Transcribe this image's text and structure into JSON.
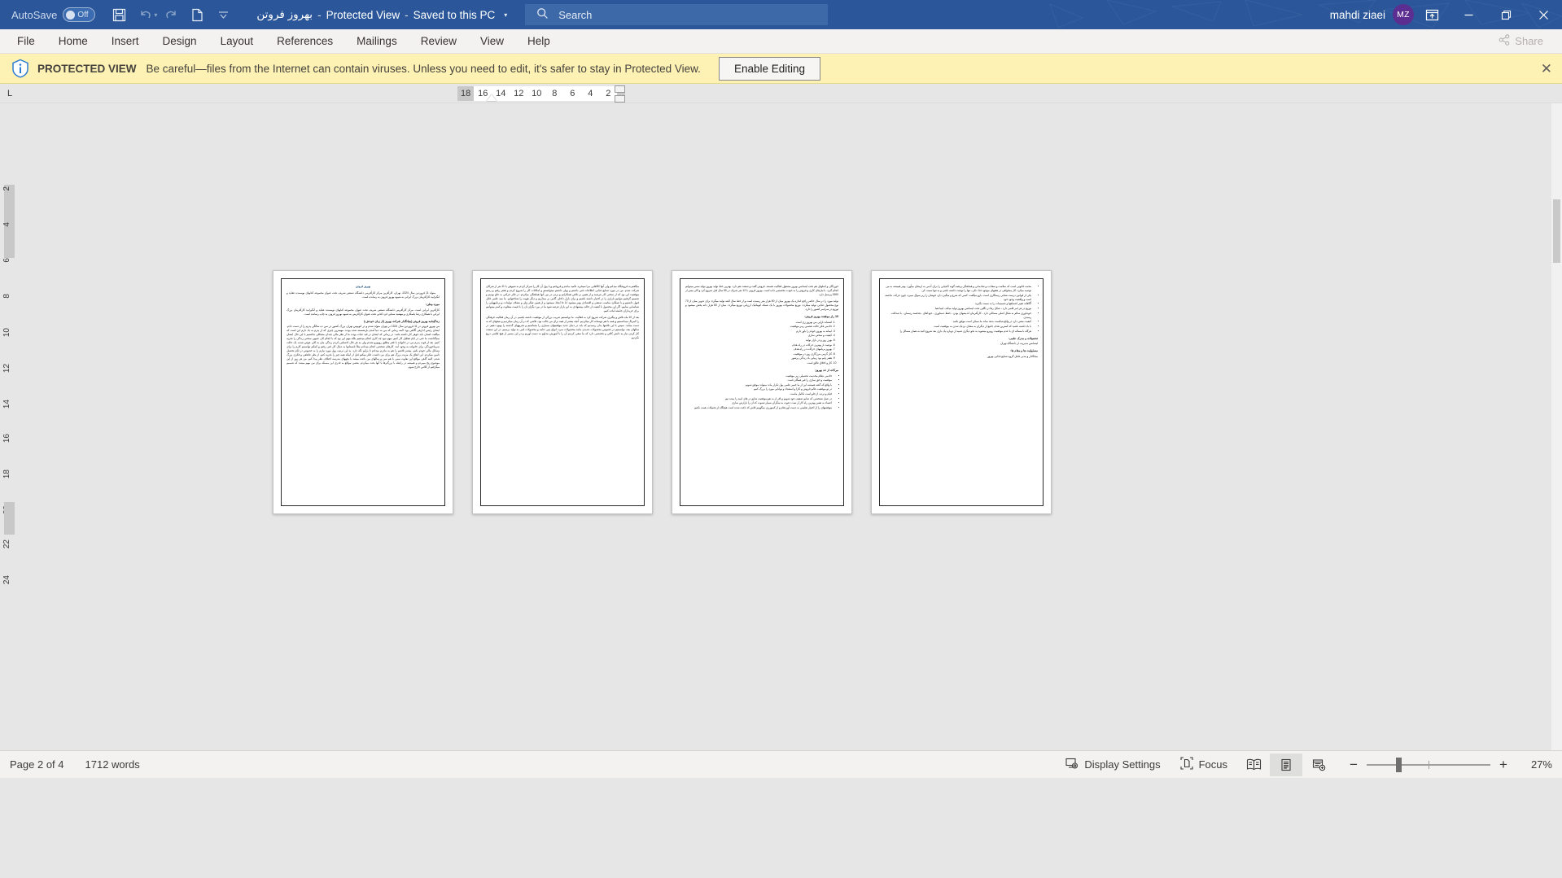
{
  "titlebar": {
    "autosave_label": "AutoSave",
    "autosave_state": "Off",
    "doc_name": "بهروز فروتن",
    "protected_view": "Protected View",
    "saved_state": "Saved to this PC",
    "sep": "-",
    "search_placeholder": "Search",
    "user_name": "mahdi ziaei",
    "avatar_initials": "MZ",
    "icons": {
      "save": "save-icon",
      "undo": "undo-icon",
      "redo": "redo-icon",
      "new": "new-document-icon",
      "customize": "customize-quick-access-toolbar-icon",
      "search": "search-icon",
      "ribbon_display": "ribbon-display-options-icon",
      "minimize": "minimize-icon",
      "restore": "restore-icon",
      "close": "close-icon"
    },
    "accent_color": "#2b579a",
    "avatar_color": "#5c2e91"
  },
  "ribbon": {
    "tabs": [
      {
        "label": "File"
      },
      {
        "label": "Home"
      },
      {
        "label": "Insert"
      },
      {
        "label": "Design"
      },
      {
        "label": "Layout"
      },
      {
        "label": "References"
      },
      {
        "label": "Mailings"
      },
      {
        "label": "Review"
      },
      {
        "label": "View"
      },
      {
        "label": "Help"
      }
    ],
    "share_label": "Share"
  },
  "protected_view": {
    "badge": "PROTECTED VIEW",
    "message": "Be careful—files from the Internet can contain viruses. Unless you need to edit, it's safer to stay in Protected View.",
    "enable_button": "Enable Editing",
    "close_glyph": "✕",
    "bar_color": "#fdf2b3"
  },
  "ruler": {
    "corner_glyph": "L",
    "margin_label": "18",
    "ticks": [
      "16",
      "14",
      "12",
      "10",
      "8",
      "6",
      "4",
      "2"
    ],
    "vertical_ticks": [
      "2",
      "4",
      "6",
      "8",
      "10",
      "12",
      "14",
      "16",
      "18",
      "20",
      "22",
      "24"
    ]
  },
  "document": {
    "pages": [
      {
        "title": "بهروز فروتن",
        "blocks": [
          {
            "type": "p",
            "text": "متولد 11 فروردین سال 1324، تهران، کارآفرین مرکز کارآفرینی دانشگاه صنعتی شریف تحت عنوان مجموعه کتابهای نویسنده عقاید و انگیزانید کارآفرینان بزرگ ایرانی به شیوه بهروز فروتن به رسانده است."
          },
          {
            "type": "h",
            "text": "موزه وطن:"
          },
          {
            "type": "p",
            "text": "کارآفرین ایرانی است. مرکز کارآفرینی دانشگاه صنعتی شریف تحت عنوان مجموعه کتابهای نویسنده عقاید و انگیزانید کارآفرینان بزرگ ایرانی با همکاری رضا پاسکاری و مهشید سنایی فرد کتابی تحت عنوان کارآفرینی به شیوه بهروز فروتن به چاپ رسانده است."
          },
          {
            "type": "h",
            "text": "زندگینامه بهروز فروتن (بنیانگذار شرکت بهروز (از زبان خودش:)"
          },
          {
            "type": "p",
            "text": "من بهروز فروتن در 11 فروردین سال 1324 در تهران متولد شدم و در اتوبوس تهران بزرگ کشور در سن ده سالگی پدرم را از دست دادم. ایشان رئیس ادارهی آگاهی بود. البته زمانی که من به دنیا آمدم بازنشسته شده بودند. مهمترین چیزی که از پدرم به یاد دارم این است که میگفت انسان باید جوهر کار داشته باشد. در زمانی که ایشان در قید حیات بودند ما از نظر مالی چندان مشکلی نداشتیم با این حال ایشان نمیگذاشت ما حتی در ایام تعطیل کار کنیم. مهم نبود چه کاری انجام میدهیم بلکه مهم این بود که با انجام کار، جنبهی سختی زندگی را تجربه کنیم. بعد از فوت پدرم من در خانواده با فقر مطلق روبهرو نشدم ولی به هر حال احساس کردم زندگی مان به کلی عوض شده، یک حالت سرماخوردگی برای خانواده به وجود آمد. کارهای شخصی انجام میدادم مثلاً تابستانها به دنبال کار فنی رفتم و کمکم توانستم کارم را برای مسائل مالی خودم بکنم. بیشتر تلاشم را هم به مادرم میدادم تا برایم نگه دارد. به این ترتیب پول مورد نیازم را به خصوص در ایام تحصیل تأمین میکردم. این اتفاق یک مزیت بزرگ هم برای من داشت، فکر میکنم قبل از اینکه همه چیز را تجربه کنم، از نظر عاطفی و فکری بزرگ شدم. البته گاهی مواقع این تفاوت سنی با هم سن و سالهای من باعث میشد با بچههای مدرسه اختلاف نظر پیدا کنم. من هر روز از این موضوع رنج میبردم و همیشه در رابطه با بزرگترها با آنها بحث میکردم. بعضی مواقع به قدری این مسئله برای من مهم میشد که تصمیم میگرفتم از کلاس خارج شوم."
          }
        ]
      },
      {
        "blocks": [
          {
            "type": "p",
            "text": "میگفتم به فروشگاه میدانم ولی آنها کالاهایی مرا نمیخرید ناامید ماندم و فروختم و با پول آن کار را تمرکز کردم به شیوهی با 11 نفر از شرکای شرکت شدم. من در مورد صنایع غذایی اطلاعات فنی داشتم و پولی داشتم میتوانستم و امکانات کار را شروع کردم و هفتر رفتم و رسم موفقیت این بود که از سختی کار نترسید و از همین بر تلاش همکارانم و بردن در بین آنها هماهنگی میکردم. در فکر حرکتی به جلو بودیم و تصمیم گرفتیم بتوانیم بازاری را در اختیار داشته باشیم و برای بازار داخلی گامی بر میداریم و دیگر هویت را شناختهایم. ما بنیه علمی قابل قبول داشتیم و با عملکرد مناسب صنعتی و اقتصادی بهتر میشود. آیا جا ایجاد نمیشود و از همین تفکر ملی و شفاف تولیدات و برنامههایی را شناسایی نماییم. اگر این محصول با کیفیت از حالت پیشنهادی به این بازار عرضه شود ما در بین دیگران آن را با قیمت متفاوت و کمتر میتوانیم برای خریداران جامعه آماده کنیم."
          },
          {
            "type": "p",
            "text": "بعد از 10 ماه تلاش و پیگیری شرکت شروع کرد به فعالیت. ما توانستیم ضریب بزرگی از موفقیت داشته باشیم. در آن زمان فعالیت فرهنگی را کمرنگ میدانستیم و همه با هم دوستانه کار میکردیم. آنچه بیشتر از همه برای من جالب بود، تلاشی که در آن زمان میکردیم و نتیجهای که به دست میآمد. سپس با این تلاشها بدان رسیدیم که باید در دنیای جدید موقعیتهای بسیاری را بشناسیم و تجربههای گذشته را بهبود دهیم. در سالهای بعد، توانستیم در خصوص محصولات جدیدی مانند محصولات سرد، انواع پنیر، خامه و محصولات لبنی به تولید برسیم. در این صنعت کار کردن نیاز به دانش کافی و تخصصی دارد که ما سعی کردیم آن را با آموزش مداوم به دست آوریم و در این مسیر از هیچ تلاشی دریغ نکردیم."
          }
        ]
      },
      {
        "blocks": [
          {
            "type": "p",
            "text": "خوردگان و اصلهای هم تحت لیسانس بهروز مشغول فعالیت هستند. فروش گفت و صنعت هم دارد. بهترین خط تولید بهروز تولید سس میتوانم انجام گیرد. با نیازهای کاری و فروش را به خودت تخصصی داده است. بهروز فروتن با 12 نفر شریک در 50 سال قبل شروع کرد و الان بیش از 1500 پرسنل دارد."
          },
          {
            "type": "p",
            "text": "تولید مورد را در سال حاضر راجع اندازه یک بهروز میان از 60 هزار متر رسیده است و از خط سال البته تولید میگردد برای تدوین میان از 70 نوع محصول غذایی تولید میگردد. توزیع محصولات بهروز با یک شبکه اتوماتیک ارزیابی توزیع میگردد. میان از 60 هزار دانه پخش میشود و توزیع در سراسر کشور را دارد."
          },
          {
            "type": "h",
            "text": "10 راز موفقت بهروز فروتن:"
          },
          {
            "type": "ol",
            "items": [
              "اشتباه دارایی من بهروز زی است",
              "خادمی فکر حالت تعصبی رمز موفقیت",
              "ایمانه به بهروز خودم را باور دارم",
              "کیفیت و سختی سازی",
              "بهرز روز و در بازار تولید",
              "نوعیت از بهترین حرکات در راه هدف",
              "بهروز برنامهای حرکات در راه هدف",
              "کار گرمی مرزگاری روز در موفقیت",
              "هفتر پایم بود زیبایی باد زندگی پرشور",
              "کار و اخلاق عالق است"
            ]
          },
          {
            "type": "h",
            "text": "مرکات از حد بهروز:"
          },
          {
            "type": "ul",
            "items": [
              "خادمی نظام مخدمت تحصیلی زیر موفقیت",
              "موفقیت و حق سازی را غیر همگان است",
              "با واقع که گفته همیشه این از ما خمیر علمی پول تکرار ماند میتواند موفق شویم",
              "در تو موفقیت عالم فروش و کارا و استعداد و توانایی مورد را بزرگ کنیم",
              "قیام و تردید از جلو است تکامل ماست",
              "در عمل تشخصی که شایم ضعیف خود شویم و افر از به نعو موفقیت شایم در های امید را ببنده تیم",
              "اعتماد به نفس بهترین راه کار از تمت دعوت به بینگران بسیار شنوت که آن را بازارش سازی",
              "موفقیتهای را از اختیار تعلیمی به دست آوردهام و از کمبورزی میگوییم تلاش کد باعث شده است هیچگاه از تحمیلات همت نکنیم"
            ]
          }
        ]
      },
      {
        "blocks": [
          {
            "type": "ul",
            "items": [
              "محبت قانونی است که سلامت و سعادت و شادمانی و هماهنگی و همه گونه کامیابی را برای آدمی به ارمغان میآورد. بهتر همیشه به من توصیه میکرد، کار میخواهی در هفتهای موجود غذا، تکی، تنها را نوشت داشته باشی و به تنها سمت کن",
              "یکی از قوانین درست نشانی رستگاری است، بارو میگفت: کسی که شرع و میگیرد دارد خوشان را زیر سوال میبرد، چون حرکت نداشته است و واقعیت وجود خود",
              "آگاهانه تغییر اشتباهها و تصمیمات را به سمت بگیرید",
              "توزیع در هر امر قلمی دارد ، شکل رها در تگلین تحت لیسانس بهروز تولید میکند، لبنیا هما",
              "خودباوری سالم به شکل اصلی مسائلی دارد ، کارآفرینان اندیشهای بودن ، حفظ دستاوری ، جوداهای ، هدفمند رسمان ، با صداقت رسیدن",
              "کیفیت معنی دارد در واقع شکست بدهد نماند ما ممکن است موفق بکنید",
              "با یاد داشته باشید که کمترین هدف جامع از دیگران به معنای نزدیک شدن به موفقیت است",
              "هرگاه با مساله ای با عدم موفقیت روبرو میشوید به نحو دیگری شبیه از دوباره یک باری بعد شروع کنید به همان مسائل را"
            ]
          },
          {
            "type": "h",
            "text": "تحصیلات و مدرک علمی:"
          },
          {
            "type": "sig",
            "text": "لیسانس مدیریت از دانشگاه تهران"
          },
          {
            "type": "h",
            "text": "مسئولیت ها و مقام ها:"
          },
          {
            "type": "sig",
            "text": "بنیانگذار و مدیر عامل گروه صنایع غذایی بهروز"
          }
        ]
      }
    ]
  },
  "statusbar": {
    "page_status": "Page 2 of 4",
    "word_count": "1712 words",
    "display_settings": "Display Settings",
    "focus": "Focus",
    "zoom_out_glyph": "−",
    "zoom_in_glyph": "+",
    "zoom_level": "27%",
    "views": [
      {
        "name": "read-mode-view-button"
      },
      {
        "name": "print-layout-view-button"
      },
      {
        "name": "web-layout-view-button"
      }
    ]
  }
}
